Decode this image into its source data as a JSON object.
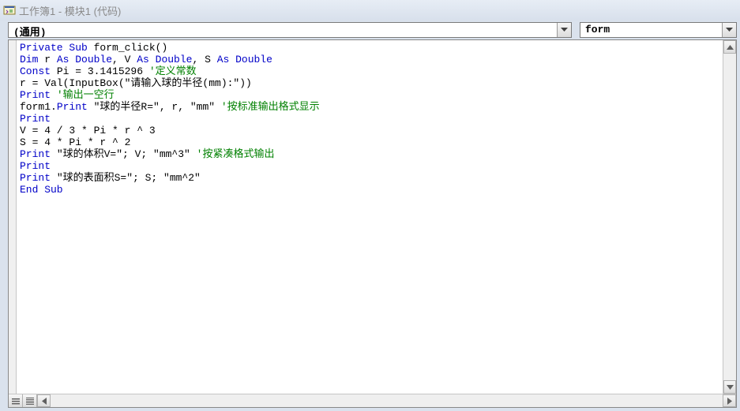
{
  "window": {
    "title": "工作簿1 - 模块1 (代码)"
  },
  "dropdowns": {
    "object": "(通用)",
    "procedure": "form"
  },
  "code_lines": [
    {
      "segments": [
        {
          "t": "Private Sub",
          "c": "kw"
        },
        {
          "t": " form_click()",
          "c": ""
        }
      ]
    },
    {
      "segments": [
        {
          "t": "Dim",
          "c": "kw"
        },
        {
          "t": " r ",
          "c": ""
        },
        {
          "t": "As Double",
          "c": "kw"
        },
        {
          "t": ", V ",
          "c": ""
        },
        {
          "t": "As Double",
          "c": "kw"
        },
        {
          "t": ", S ",
          "c": ""
        },
        {
          "t": "As Double",
          "c": "kw"
        }
      ]
    },
    {
      "segments": [
        {
          "t": "Const",
          "c": "kw"
        },
        {
          "t": " Pi = 3.1415296 ",
          "c": ""
        },
        {
          "t": "'定义常数",
          "c": "cm"
        }
      ]
    },
    {
      "segments": [
        {
          "t": "r = Val(InputBox(\"请输入球的半径(mm):\"))",
          "c": ""
        }
      ]
    },
    {
      "segments": [
        {
          "t": "Print",
          "c": "kw"
        },
        {
          "t": " ",
          "c": ""
        },
        {
          "t": "'输出一空行",
          "c": "cm"
        }
      ]
    },
    {
      "segments": [
        {
          "t": "form1.",
          "c": ""
        },
        {
          "t": "Print",
          "c": "kw"
        },
        {
          "t": " \"球的半径R=\", r, \"mm\" ",
          "c": ""
        },
        {
          "t": "'按标准输出格式显示",
          "c": "cm"
        }
      ]
    },
    {
      "segments": [
        {
          "t": "Print",
          "c": "kw"
        }
      ]
    },
    {
      "segments": [
        {
          "t": "V = 4 / 3 * Pi * r ^ 3",
          "c": ""
        }
      ]
    },
    {
      "segments": [
        {
          "t": "S = 4 * Pi * r ^ 2",
          "c": ""
        }
      ]
    },
    {
      "segments": [
        {
          "t": "Print",
          "c": "kw"
        },
        {
          "t": " \"球的体积V=\"; V; \"mm^3\" ",
          "c": ""
        },
        {
          "t": "'按紧凑格式输出",
          "c": "cm"
        }
      ]
    },
    {
      "segments": [
        {
          "t": "Print",
          "c": "kw"
        }
      ]
    },
    {
      "segments": [
        {
          "t": "Print",
          "c": "kw"
        },
        {
          "t": " \"球的表面积S=\"; S; \"mm^2\"",
          "c": ""
        }
      ]
    },
    {
      "segments": [
        {
          "t": "End Sub",
          "c": "kw"
        }
      ]
    }
  ]
}
